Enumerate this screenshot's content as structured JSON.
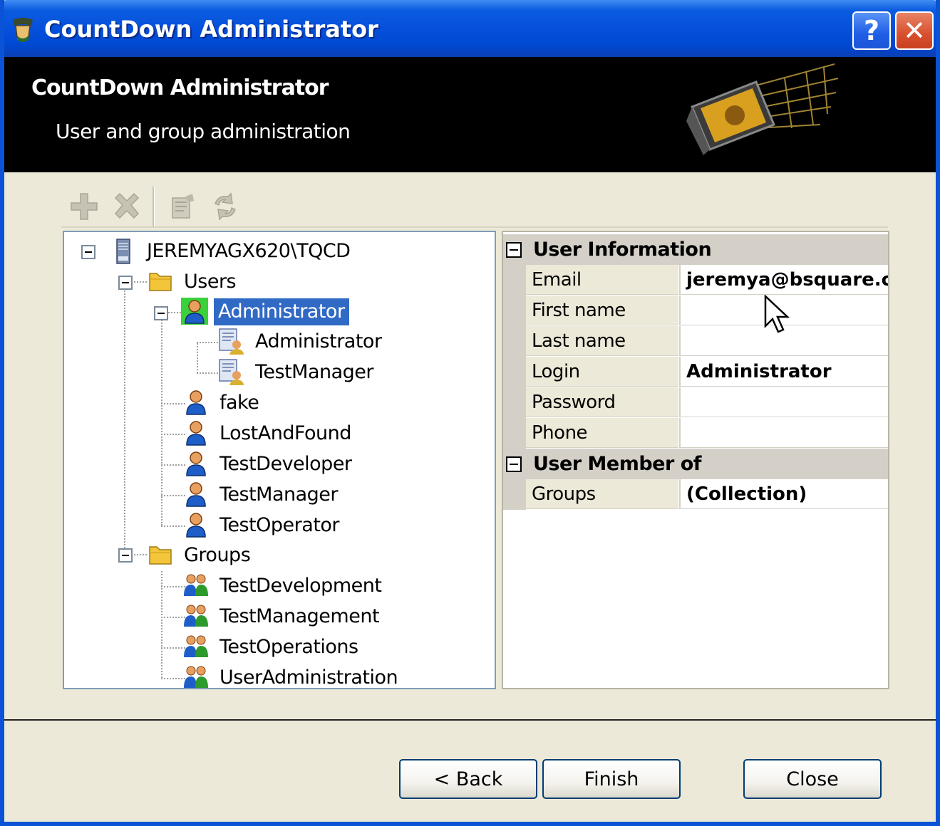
{
  "window": {
    "title": "CountDown Administrator",
    "help_glyph": "?",
    "close_glyph": "✕"
  },
  "banner": {
    "title": "CountDown Administrator",
    "subtitle": "User and group administration"
  },
  "toolbar": {
    "add_icon": "plus-icon",
    "delete_icon": "delete-x-icon",
    "properties_icon": "properties-icon",
    "refresh_icon": "refresh-icon"
  },
  "tree": {
    "root": "JEREMYAGX620\\TQCD",
    "users_folder": "Users",
    "selected_user": "Administrator",
    "selected_user_groups": [
      "Administrator",
      "TestManager"
    ],
    "users": [
      "fake",
      "LostAndFound",
      "TestDeveloper",
      "TestManager",
      "TestOperator"
    ],
    "groups_folder": "Groups",
    "groups": [
      "TestDevelopment",
      "TestManagement",
      "TestOperations",
      "UserAdministration"
    ]
  },
  "properties": {
    "user_info_label": "User Information",
    "rows": [
      {
        "name": "Email",
        "value": "jeremya@bsquare.c"
      },
      {
        "name": "First name",
        "value": ""
      },
      {
        "name": "Last name",
        "value": ""
      },
      {
        "name": "Login",
        "value": "Administrator"
      },
      {
        "name": "Password",
        "value": ""
      },
      {
        "name": "Phone",
        "value": ""
      }
    ],
    "member_of_label": "User Member of",
    "member_rows": [
      {
        "name": "Groups",
        "value": "(Collection)"
      }
    ]
  },
  "buttons": {
    "back": "< Back",
    "finish": "Finish",
    "close": "Close"
  }
}
